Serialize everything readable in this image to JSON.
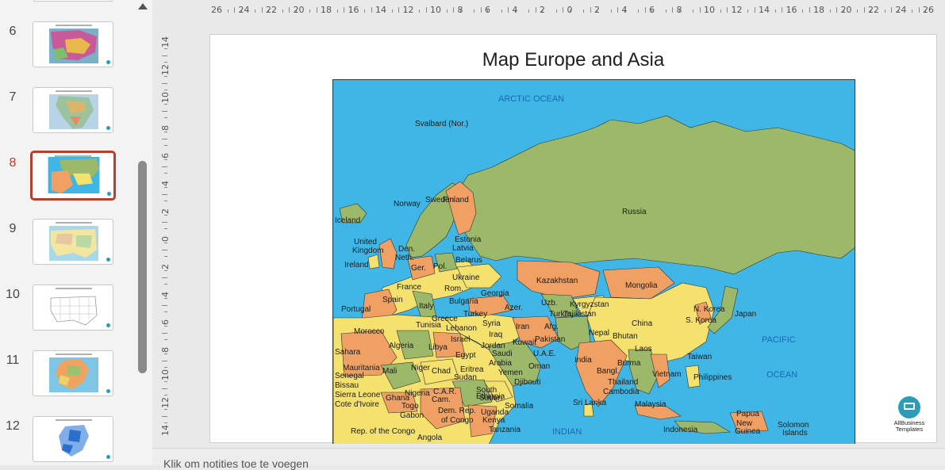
{
  "thumbnails": [
    {
      "number": "6",
      "colors": [
        "#7ab0c8",
        "#c85a9a",
        "#e8b84a",
        "#7bbf6a"
      ]
    },
    {
      "number": "7",
      "colors": [
        "#9cc3a0",
        "#d9b66a",
        "#b8d3e6",
        "#e88a6a"
      ]
    },
    {
      "number": "8",
      "colors": [
        "#3fb6e6",
        "#9cb96a",
        "#f0a062",
        "#f5e16e"
      ],
      "active": true
    },
    {
      "number": "9",
      "colors": [
        "#a8d8ea",
        "#f2e6a0",
        "#e8c6a0",
        "#b9d9a6"
      ]
    },
    {
      "number": "10",
      "colors": [
        "#ffffff",
        "#d9d9d9",
        "#eeeeee",
        "#f5f5f5"
      ]
    },
    {
      "number": "11",
      "colors": [
        "#7fc6e6",
        "#f0a35e",
        "#9bc26e",
        "#ead36a"
      ]
    },
    {
      "number": "12",
      "colors": [
        "#ffffff",
        "#2a6fc9",
        "#7faee8",
        "#dfe8f5"
      ]
    }
  ],
  "ruler": {
    "horizontal": [
      "26",
      "24",
      "22",
      "20",
      "18",
      "16",
      "14",
      "12",
      "10",
      "8",
      "6",
      "4",
      "2",
      "0",
      "2",
      "4",
      "6",
      "8",
      "10",
      "12",
      "14",
      "16",
      "18",
      "20",
      "22",
      "24",
      "26"
    ],
    "vertical": [
      "14",
      "12",
      "10",
      "8",
      "6",
      "4",
      "2",
      "0",
      "2",
      "4",
      "6",
      "8",
      "10",
      "12",
      "14"
    ]
  },
  "slide": {
    "title": "Map Europe and Asia",
    "logo_line1": "AllBusiness",
    "logo_line2": "Templates"
  },
  "map": {
    "oceans": {
      "arctic": "ARCTIC OCEAN",
      "pacific_1": "PACIFIC",
      "pacific_2": "OCEAN",
      "indian": "INDIAN"
    },
    "countries": [
      "Svalbard (Nor.)",
      "Russia",
      "Iceland",
      "Norway",
      "Sweden",
      "Finland",
      "United",
      "Kingdom",
      "Ireland",
      "Den.",
      "Neth.",
      "Estonia",
      "Latvia",
      "Belarus",
      "Ger.",
      "Pol.",
      "Ukraine",
      "France",
      "Spain",
      "Portugal",
      "Italy",
      "Rom.",
      "Bulgaria",
      "Greece",
      "Turkey",
      "Georgia",
      "Azer.",
      "Kazakhstan",
      "Mongolia",
      "Uzb.",
      "Turkm.",
      "Kyrgyzstan",
      "Tajikistan",
      "Afg.",
      "Iran",
      "Syria",
      "Iraq",
      "Lebanon",
      "Israel",
      "Jordan",
      "Kuwait",
      "Saudi",
      "Arabia",
      "U.A.E.",
      "Oman",
      "Yemen",
      "Pakistan",
      "Nepal",
      "Bhutan",
      "India",
      "China",
      "N. Korea",
      "S. Korea",
      "Japan",
      "Laos",
      "Bangl.",
      "Burma",
      "Thailand",
      "Vietnam",
      "Cambodia",
      "Taiwan",
      "Philippines",
      "Malaysia",
      "Indonesia",
      "Papua",
      "New",
      "Guinea",
      "Solomon",
      "Islands",
      "Sri Lanka",
      "Morocco",
      "Algeria",
      "Tunisia",
      "Libya",
      "Egypt",
      "Sahara",
      "Mauritania",
      "Mali",
      "Niger",
      "Chad",
      "Sudan",
      "Eritrea",
      "Djibouti",
      "Ethiopia",
      "Somalia",
      "Uganda",
      "Kenya",
      "Tanzania",
      "Senegal",
      "Bissau",
      "Sierra Leone",
      "Cote d'Ivoire",
      "Ghana",
      "Togo",
      "Nigeria",
      "Cam.",
      "C.A.R.",
      "South",
      "Sudan",
      "Gabon",
      "Dem. Rep.",
      "of Congo",
      "Rep. of the Congo",
      "Angola"
    ]
  },
  "notes": {
    "placeholder": "Klik om notities toe te voegen"
  }
}
